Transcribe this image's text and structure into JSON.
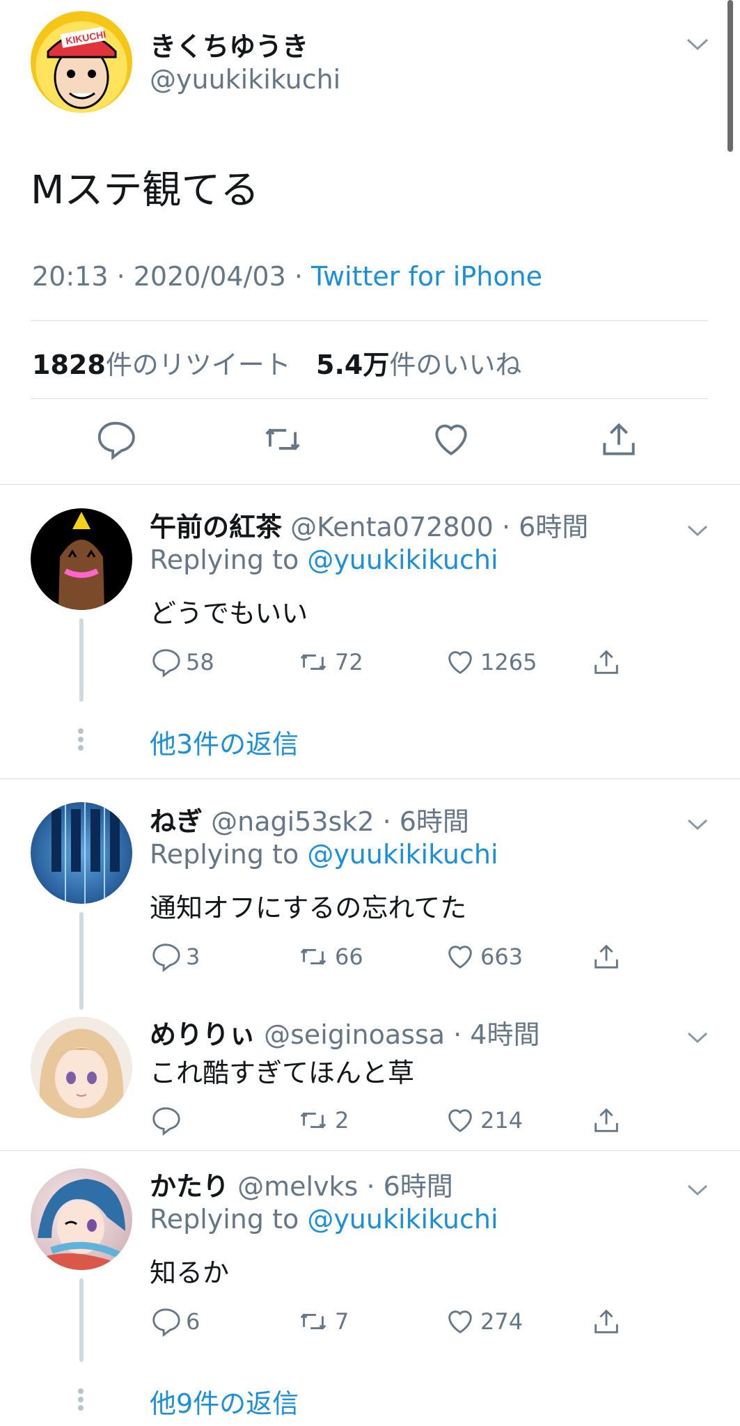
{
  "main_tweet": {
    "name": "きくちゆうき",
    "handle": "@yuukikikuchi",
    "avatar_text": "KIKUCHI",
    "text": "Mステ観てる",
    "time": "20:13 · 2020/04/03 · ",
    "source": "Twitter for iPhone",
    "retweets_num": "1828",
    "retweets_label": "件のリツイート",
    "likes_num": "5.4万",
    "likes_label": "件のいいね"
  },
  "replying_prefix": "Replying to ",
  "replies": [
    {
      "name": "午前の紅茶",
      "handle": "@Kenta072800",
      "time": "· 6時間",
      "replying_to": "@yuukikikuchi",
      "text": "どうでもいい",
      "replies": "58",
      "retweets": "72",
      "likes": "1265",
      "more": "他3件の返信"
    },
    {
      "name": "ねぎ",
      "handle": "@nagi53sk2",
      "time": "· 6時間",
      "replying_to": "@yuukikikuchi",
      "text": "通知オフにするの忘れてた",
      "replies": "3",
      "retweets": "66",
      "likes": "663"
    },
    {
      "name": "めりりぃ",
      "handle": "@seiginoassa",
      "time": "· 4時間",
      "text": "これ酷すぎてほんと草",
      "replies": "",
      "retweets": "2",
      "likes": "214"
    },
    {
      "name": "かたり",
      "handle": "@melvks",
      "time": "· 6時間",
      "replying_to": "@yuukikikuchi",
      "text": "知るか",
      "replies": "6",
      "retweets": "7",
      "likes": "274",
      "more": "他9件の返信"
    }
  ],
  "icons": [
    "reply-icon",
    "retweet-icon",
    "like-icon",
    "share-icon",
    "chevron-down-icon"
  ],
  "colors": {
    "link": "#1d8ed8",
    "secondary": "#657786",
    "divider": "#d8dee3"
  }
}
